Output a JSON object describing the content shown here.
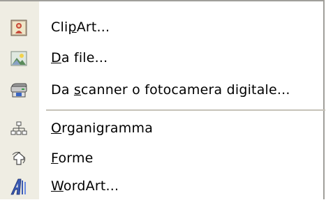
{
  "menu": {
    "items": [
      {
        "id": "clipart",
        "label": "ClipArt...",
        "accesskey": "p",
        "icon": "clipart-icon"
      },
      {
        "id": "da-file",
        "label": "Da file...",
        "accesskey": "D",
        "icon": "picture-file-icon"
      },
      {
        "id": "da-scanner",
        "label": "Da scanner o fotocamera digitale...",
        "accesskey": "s",
        "icon": "scanner-icon"
      },
      {
        "id": "organigramma",
        "label": "Organigramma",
        "accesskey": "O",
        "icon": "org-chart-icon"
      },
      {
        "id": "forme",
        "label": "Forme",
        "accesskey": "F",
        "icon": "shapes-icon"
      },
      {
        "id": "wordart",
        "label": "WordArt...",
        "accesskey": "W",
        "icon": "wordart-icon"
      }
    ]
  },
  "colors": {
    "gutter": "#efede3",
    "border": "#a09f9a",
    "separator": "#c5c2b8"
  }
}
